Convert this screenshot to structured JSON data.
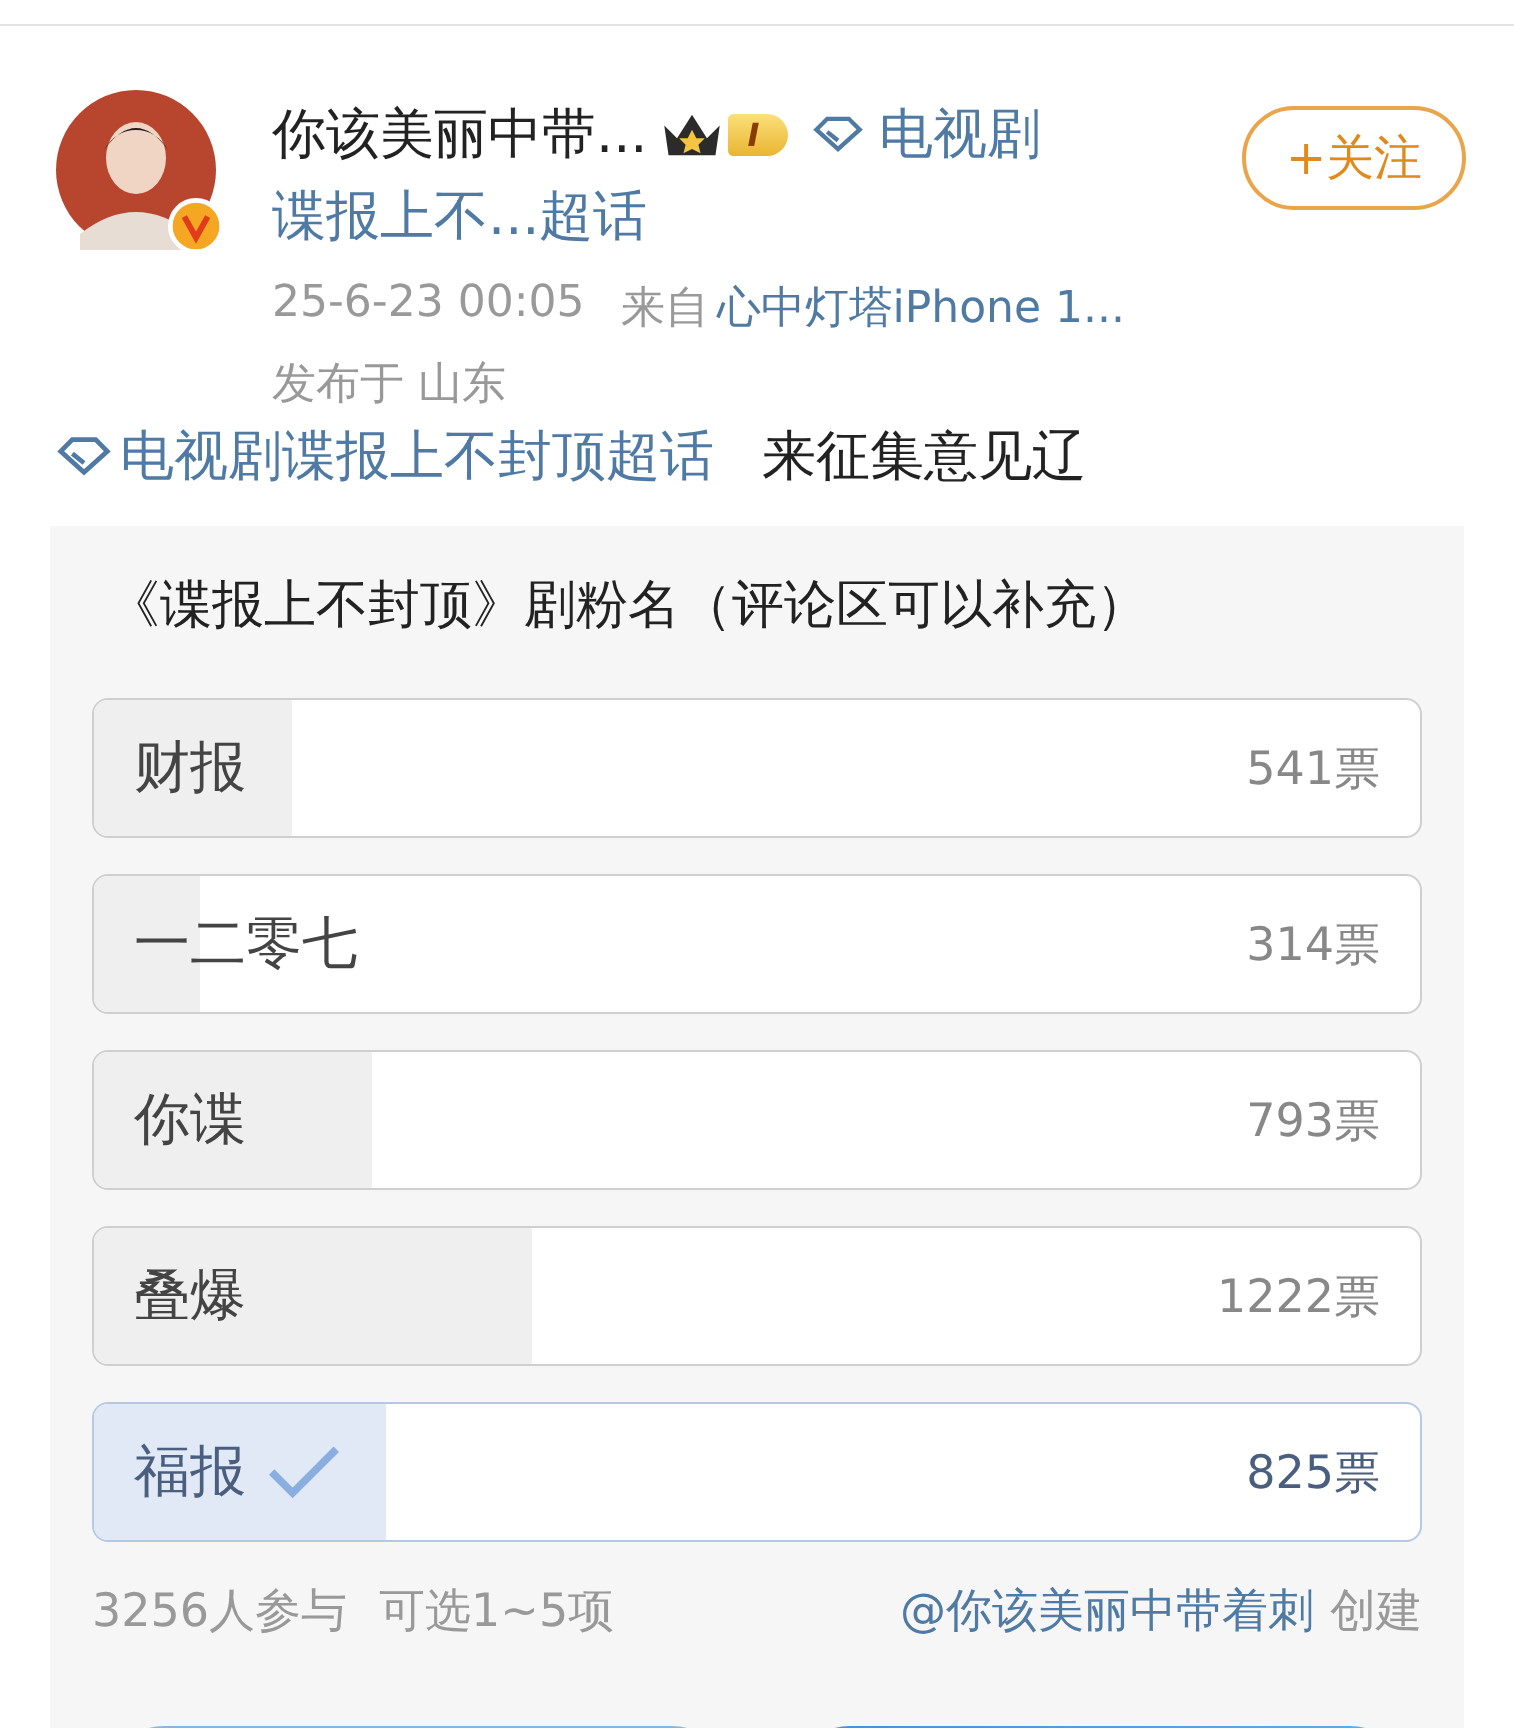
{
  "post": {
    "author": "你该美丽中带...",
    "member_badge": "I",
    "topic_link": [
      "电视剧",
      "谍报上不...超话"
    ],
    "follow_button": "+关注",
    "time": "25-6-23 00:05",
    "source_prefix": "来自",
    "source": "心中灯塔iPhone 1...",
    "location": "发布于 山东"
  },
  "body": {
    "topic": "电视剧谍报上不封顶超话",
    "text": "来征集意见辽"
  },
  "poll": {
    "title": "《谍报上不封顶》剧粉名（评论区可以补充）",
    "options": [
      {
        "label": "财报",
        "votes": "541票",
        "level": 0.15,
        "selected": false
      },
      {
        "label": "一二零七",
        "votes": "314票",
        "level": 0.08,
        "selected": false
      },
      {
        "label": "你谍",
        "votes": "793票",
        "level": 0.21,
        "selected": false
      },
      {
        "label": "叠爆",
        "votes": "1222票",
        "level": 0.33,
        "selected": false
      },
      {
        "label": "福报",
        "votes": "825票",
        "level": 0.22,
        "selected": true
      }
    ],
    "participants": "3256人参与",
    "choice_rule": "可选1~5项",
    "creator": "@你该美丽中带着刺",
    "creator_suffix": "创建"
  }
}
